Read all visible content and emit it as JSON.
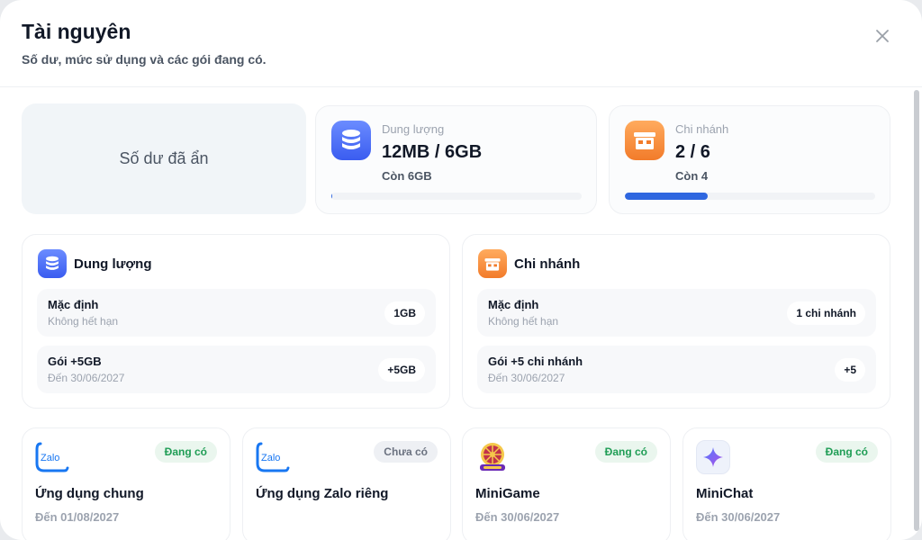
{
  "header": {
    "title": "Tài nguyên",
    "subtitle": "Số dư, mức sử dụng và các gói đang có."
  },
  "balance": {
    "label": "Số dư đã ẩn"
  },
  "stats": [
    {
      "label": "Dung lượng",
      "value": "12MB / 6GB",
      "remain": "Còn 6GB",
      "progress": 0.002,
      "icon": "database-icon"
    },
    {
      "label": "Chi nhánh",
      "value": "2 / 6",
      "remain": "Còn 4",
      "progress": 0.33,
      "icon": "storefront-icon"
    }
  ],
  "details": [
    {
      "title": "Dung lượng",
      "icon": "database-icon",
      "rows": [
        {
          "name": "Mặc định",
          "sub": "Không hết hạn",
          "badge": "1GB"
        },
        {
          "name": "Gói +5GB",
          "sub": "Đến 30/06/2027",
          "badge": "+5GB"
        }
      ]
    },
    {
      "title": "Chi nhánh",
      "icon": "storefront-icon",
      "rows": [
        {
          "name": "Mặc định",
          "sub": "Không hết hạn",
          "badge": "1 chi nhánh"
        },
        {
          "name": "Gói +5 chi nhánh",
          "sub": "Đến 30/06/2027",
          "badge": "+5"
        }
      ]
    }
  ],
  "services": [
    {
      "name": "Ứng dụng chung",
      "date": "Đến 01/08/2027",
      "status": "Đang có",
      "logo": "zalo-logo",
      "logo_text": "Zalo"
    },
    {
      "name": "Ứng dụng Zalo riêng",
      "date": "",
      "status": "Chưa có",
      "logo": "zalo-logo",
      "logo_text": "Zalo"
    },
    {
      "name": "MiniGame",
      "date": "Đến 30/06/2027",
      "status": "Đang có",
      "logo": "wheel-logo"
    },
    {
      "name": "MiniChat",
      "date": "Đến 30/06/2027",
      "status": "Đang có",
      "logo": "sparkle-icon"
    }
  ],
  "colors": {
    "accent": "#2f67e0",
    "active_badge_text": "#1f9d55",
    "active_badge_bg": "#eaf6ee"
  }
}
